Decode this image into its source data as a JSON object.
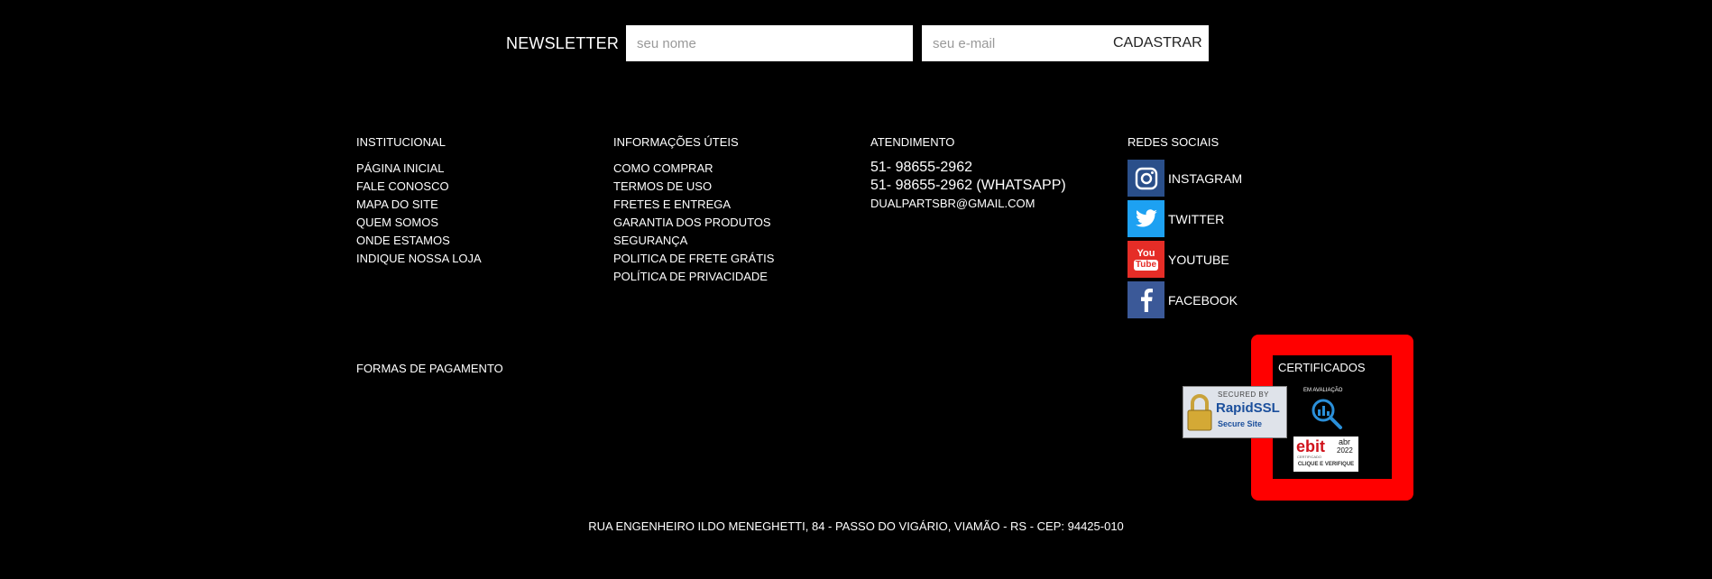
{
  "newsletter": {
    "title": "NEWSLETTER",
    "name_placeholder": "seu nome",
    "email_placeholder": "seu e-mail",
    "submit_label": "CADASTRAR"
  },
  "institucional": {
    "title": "INSTITUCIONAL",
    "items": [
      "PÁGINA INICIAL",
      "FALE CONOSCO",
      "MAPA DO SITE",
      "QUEM SOMOS",
      "ONDE ESTAMOS",
      "INDIQUE NOSSA LOJA"
    ]
  },
  "informacoes": {
    "title": "INFORMAÇÕES ÚTEIS",
    "items": [
      "COMO COMPRAR",
      "TERMOS DE USO",
      "FRETES E ENTREGA",
      "GARANTIA DOS PRODUTOS",
      "SEGURANÇA",
      "POLITICA DE FRETE GRÁTIS",
      "POLÍTICA DE PRIVACIDADE"
    ]
  },
  "atendimento": {
    "title": "ATENDIMENTO",
    "phone": "51- 98655-2962",
    "whatsapp": "51- 98655-2962 (WHATSAPP)",
    "email": "DUALPARTSBR@GMAIL.COM"
  },
  "redes": {
    "title": "REDES SOCIAIS",
    "items": [
      {
        "label": "INSTAGRAM",
        "icon": "instagram-icon",
        "color": "#2a4f8a"
      },
      {
        "label": "TWITTER",
        "icon": "twitter-icon",
        "color": "#1da1f2"
      },
      {
        "label": "YOUTUBE",
        "icon": "youtube-icon",
        "color": "#e52d27"
      },
      {
        "label": "FACEBOOK",
        "icon": "facebook-icon",
        "color": "#3b5998"
      }
    ]
  },
  "pagamento": {
    "title": "FORMAS DE PAGAMENTO"
  },
  "certificados": {
    "title": "CERTIFICADOS",
    "secure_top": "SECURED BY",
    "secure_brand": "RapidSSL",
    "secure_bottom": "Secure Site",
    "eval_label": "EM AVALIAÇÃO",
    "ebit_brand": "ebit",
    "ebit_sub": "CERTIFICADO",
    "ebit_month": "abr",
    "ebit_year": "2022",
    "ebit_cta": "CLIQUE E VERIFIQUE",
    "highlight_color": "#ff0000"
  },
  "footer": {
    "address": "RUA ENGENHEIRO ILDO MENEGHETTI, 84 - PASSO DO VIGÁRIO, VIAMÃO - RS - CEP: 94425-010"
  }
}
